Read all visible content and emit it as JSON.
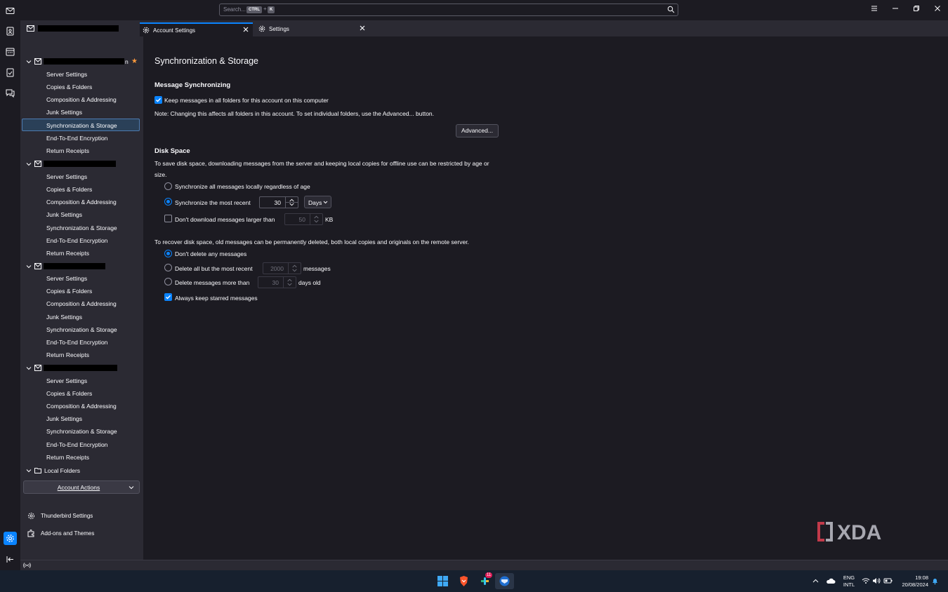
{
  "search": {
    "placeholder": "Search...",
    "key1": "CTRL",
    "plus": "+",
    "key2": "K"
  },
  "tabs": [
    {
      "label": "Account Settings",
      "icon": "account-settings-icon"
    },
    {
      "label": "Settings",
      "icon": "gear-icon"
    }
  ],
  "sidebar": {
    "accounts": [
      {
        "items": [
          "Server Settings",
          "Copies & Folders",
          "Composition & Addressing",
          "Junk Settings",
          "Synchronization & Storage",
          "End-To-End Encryption",
          "Return Receipts"
        ],
        "name_suffix": "n"
      },
      {
        "items": [
          "Server Settings",
          "Copies & Folders",
          "Composition & Addressing",
          "Junk Settings",
          "Synchronization & Storage",
          "End-To-End Encryption",
          "Return Receipts"
        ]
      },
      {
        "items": [
          "Server Settings",
          "Copies & Folders",
          "Composition & Addressing",
          "Junk Settings",
          "Synchronization & Storage",
          "End-To-End Encryption",
          "Return Receipts"
        ]
      },
      {
        "items": [
          "Server Settings",
          "Copies & Folders",
          "Composition & Addressing",
          "Junk Settings",
          "Synchronization & Storage",
          "End-To-End Encryption",
          "Return Receipts"
        ]
      }
    ],
    "local_folders": "Local Folders",
    "account_actions": "Account Actions",
    "thunderbird_settings": "Thunderbird Settings",
    "addons": "Add-ons and Themes"
  },
  "main": {
    "title": "Synchronization & Storage",
    "msg_sync_heading": "Message Synchronizing",
    "keep_messages_label": "Keep messages in all folders for this account on this computer",
    "note": "Note: Changing this affects all folders in this account. To set individual folders, use the Advanced... button.",
    "advanced_button": "Advanced...",
    "disk_heading": "Disk Space",
    "disk_desc_1": "To save disk space, downloading messages from the server and keeping local copies for offline use can be restricted by age or",
    "disk_desc_2": "size.",
    "sync_all_label": "Synchronize all messages locally regardless of age",
    "sync_recent_label": "Synchronize the most recent",
    "sync_recent_value": "30",
    "sync_recent_unit": "Days",
    "dont_download_label": "Don't download messages larger than",
    "dont_download_value": "50",
    "dont_download_unit": "KB",
    "recover_desc": "To recover disk space, old messages can be permanently deleted, both local copies and originals on the remote server.",
    "dont_delete_label": "Don't delete any messages",
    "delete_all_label": "Delete all but the most recent",
    "delete_all_value": "2000",
    "delete_all_unit": "messages",
    "delete_more_label": "Delete messages more than",
    "delete_more_value": "30",
    "delete_more_unit": "days old",
    "keep_starred_label": "Always keep starred messages"
  },
  "watermark": "XDA",
  "taskbar": {
    "lang1": "ENG",
    "lang2": "INTL",
    "time": "19:08",
    "date": "20/08/2024",
    "badge": "11"
  },
  "colors": {
    "accent": "#0a84ff",
    "bg": "#1c1b22",
    "panel": "#2b2a33"
  }
}
